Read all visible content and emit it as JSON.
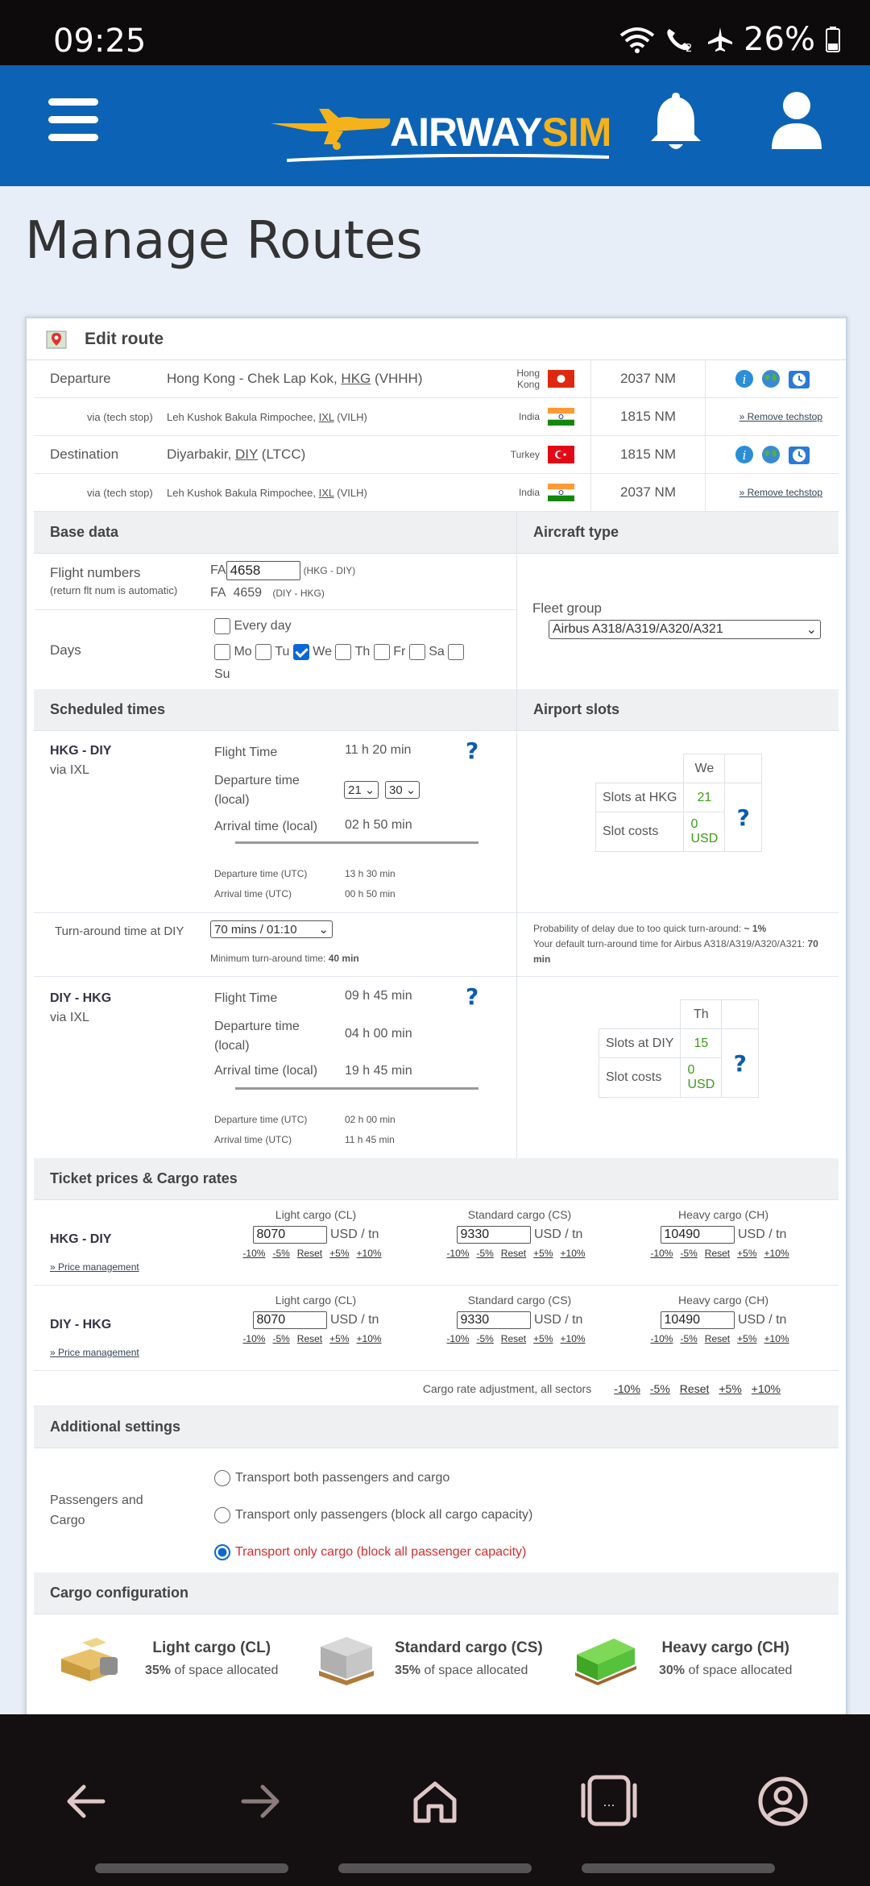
{
  "status": {
    "time": "09:25",
    "battery": "26%"
  },
  "header": {
    "logo_part1": "AIRWAY",
    "logo_part2": "SIM"
  },
  "page_title": "Manage Routes",
  "card_title": "Edit route",
  "route": [
    {
      "label": "Departure",
      "airport": "Hong Kong - Chek Lap Kok, ",
      "iata": "HKG",
      "icao": " (VHHH)",
      "country": "Hong Kong",
      "distance": "2037 NM",
      "flag": "hk"
    },
    {
      "label": "via (tech stop)",
      "airport": "Leh Kushok Bakula Rimpochee, ",
      "iata": "IXL",
      "icao": " (VILH)",
      "country": "India",
      "distance": "1815 NM",
      "flag": "in",
      "action": "» Remove techstop"
    },
    {
      "label": "Destination",
      "airport": "Diyarbakir, ",
      "iata": "DIY",
      "icao": " (LTCC)",
      "country": "Turkey",
      "distance": "1815 NM",
      "flag": "tr"
    },
    {
      "label": "via (tech stop)",
      "airport": "Leh Kushok Bakula Rimpochee, ",
      "iata": "IXL",
      "icao": " (VILH)",
      "country": "India",
      "distance": "2037 NM",
      "flag": "in",
      "action": "» Remove techstop"
    }
  ],
  "base_data": {
    "title": "Base data",
    "flight_numbers_label": "Flight numbers",
    "flight_numbers_note": "(return flt num is automatic)",
    "prefix": "FA",
    "flight_no": "4658",
    "flight_no_route": "(HKG - DIY)",
    "return_no": "4659",
    "return_route": "(DIY - HKG)",
    "days_label": "Days",
    "every_day": "Every day",
    "days": [
      "Mo",
      "Tu",
      "We",
      "Th",
      "Fr",
      "Sa",
      "Su"
    ],
    "days_checked": [
      false,
      false,
      true,
      false,
      false,
      false,
      false
    ]
  },
  "aircraft": {
    "title": "Aircraft type",
    "fleet_label": "Fleet group",
    "fleet_value": "Airbus A318/A319/A320/A321"
  },
  "scheduled": {
    "title": "Scheduled times",
    "slots_title": "Airport slots",
    "out": {
      "route": "HKG - DIY",
      "via": "via IXL",
      "flight_time_label": "Flight Time",
      "flight_time": "11 h 20 min",
      "dep_label": "Departure time (local)",
      "dep_h": "21",
      "dep_m": "30",
      "arr_label": "Arrival time (local)",
      "arr": "02 h 50 min",
      "dep_utc_label": "Departure time (UTC)",
      "dep_utc": "13 h 30 min",
      "arr_utc_label": "Arrival time (UTC)",
      "arr_utc": "00 h 50 min",
      "slot_day": "We",
      "slots_label": "Slots at HKG",
      "slots": "21",
      "cost_label": "Slot costs",
      "cost": "0 USD"
    },
    "turn": {
      "label": "Turn-around time at DIY",
      "value": "70 mins / 01:10",
      "min_label": "Minimum turn-around time: ",
      "min_value": "40 min",
      "prob_label": "Probability of delay due to too quick turn-around: ",
      "prob_value": "~ 1%",
      "default_text": "Your default turn-around time for Airbus A318/A319/A320/A321: ",
      "default_value": "70 min"
    },
    "back": {
      "route": "DIY - HKG",
      "via": "via IXL",
      "flight_time_label": "Flight Time",
      "flight_time": "09 h 45 min",
      "dep_label": "Departure time (local)",
      "dep": "04 h 00 min",
      "arr_label": "Arrival time (local)",
      "arr": "19 h 45 min",
      "dep_utc_label": "Departure time (UTC)",
      "dep_utc": "02 h 00 min",
      "arr_utc_label": "Arrival time (UTC)",
      "arr_utc": "11 h 45 min",
      "slot_day": "Th",
      "slots_label": "Slots at DIY",
      "slots": "15",
      "cost_label": "Slot costs",
      "cost": "0 USD"
    }
  },
  "prices": {
    "title": "Ticket prices & Cargo rates",
    "price_mgmt": "» Price management",
    "unit": "USD / tn",
    "adjust": [
      "-10%",
      "-5%",
      "Reset",
      "+5%",
      "+10%"
    ],
    "cols": [
      "Light cargo (CL)",
      "Standard cargo (CS)",
      "Heavy cargo (CH)"
    ],
    "rows": [
      {
        "route": "HKG - DIY",
        "values": [
          "8070",
          "9330",
          "10490"
        ]
      },
      {
        "route": "DIY - HKG",
        "values": [
          "8070",
          "9330",
          "10490"
        ]
      }
    ],
    "all_label": "Cargo rate adjustment, all sectors"
  },
  "additional": {
    "title": "Additional settings",
    "label": "Passengers and Cargo",
    "options": [
      "Transport both passengers and cargo",
      "Transport only passengers (block all cargo capacity)",
      "Transport only cargo (block all passenger capacity)"
    ],
    "selected": 2
  },
  "cargo_config": {
    "title": "Cargo configuration",
    "items": [
      {
        "name": "Light cargo (CL)",
        "pct": "35%",
        "text": " of space allocated"
      },
      {
        "name": "Standard cargo (CS)",
        "pct": "35%",
        "text": " of space allocated"
      },
      {
        "name": "Heavy cargo (CH)",
        "pct": "30%",
        "text": " of space allocated"
      }
    ]
  }
}
